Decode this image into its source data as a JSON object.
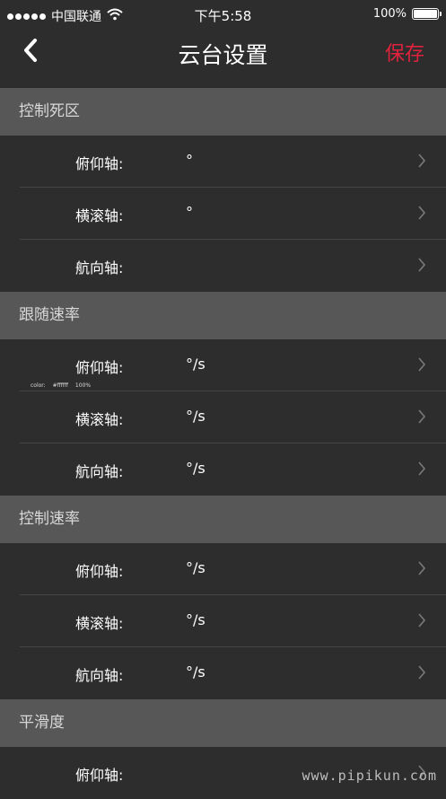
{
  "status_bar": {
    "carrier": "中国联通",
    "time": "下午5:58",
    "battery": "100%",
    "battery_level": 1.0
  },
  "nav": {
    "title": "云台设置",
    "save_label": "保存",
    "back_icon": "chevron-left-icon"
  },
  "sections": [
    {
      "title": "控制死区",
      "rows": [
        {
          "label": "俯仰轴:",
          "value": "°"
        },
        {
          "label": "横滚轴:",
          "value": "°"
        },
        {
          "label": "航向轴:",
          "value": ""
        }
      ]
    },
    {
      "title": "跟随速率",
      "rows": [
        {
          "label": "俯仰轴:",
          "value": "°/s"
        },
        {
          "label": "横滚轴:",
          "value": "°/s"
        },
        {
          "label": "航向轴:",
          "value": "°/s"
        }
      ]
    },
    {
      "title": "控制速率",
      "rows": [
        {
          "label": "俯仰轴:",
          "value": "°/s"
        },
        {
          "label": "横滚轴:",
          "value": "°/s"
        },
        {
          "label": "航向轴:",
          "value": "°/s"
        }
      ]
    },
    {
      "title": "平滑度",
      "rows": [
        {
          "label": "俯仰轴:",
          "value": ""
        }
      ]
    }
  ],
  "overlay_note": "color: #ffffff 100%",
  "watermark": "www.pipikun.com",
  "colors": {
    "background": "#2d2d2d",
    "section_header": "#575757",
    "accent_save": "#e0223d"
  }
}
